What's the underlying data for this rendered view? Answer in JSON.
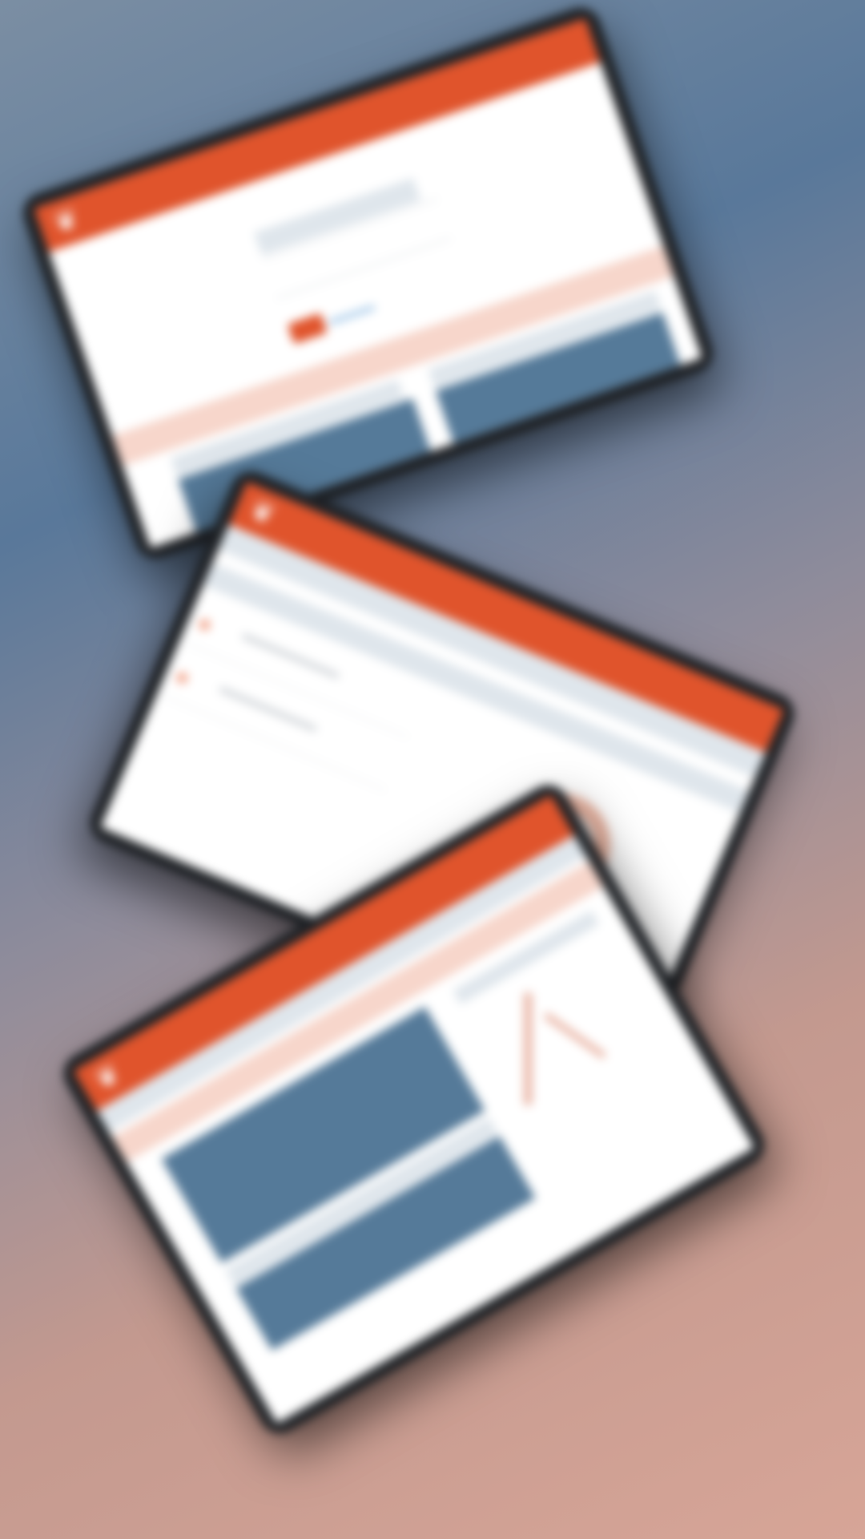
{
  "scene": {
    "background_colors": [
      "#59789a",
      "#d7a597"
    ],
    "app_accent": "#e0542c",
    "panel_color": "#557a99",
    "logo_icon": "bird-logo-icon"
  },
  "devices": [
    {
      "id": "tablet-login",
      "screen": "login"
    },
    {
      "id": "tablet-dashboard",
      "screen": "dashboard"
    },
    {
      "id": "tablet-report",
      "screen": "report"
    }
  ]
}
